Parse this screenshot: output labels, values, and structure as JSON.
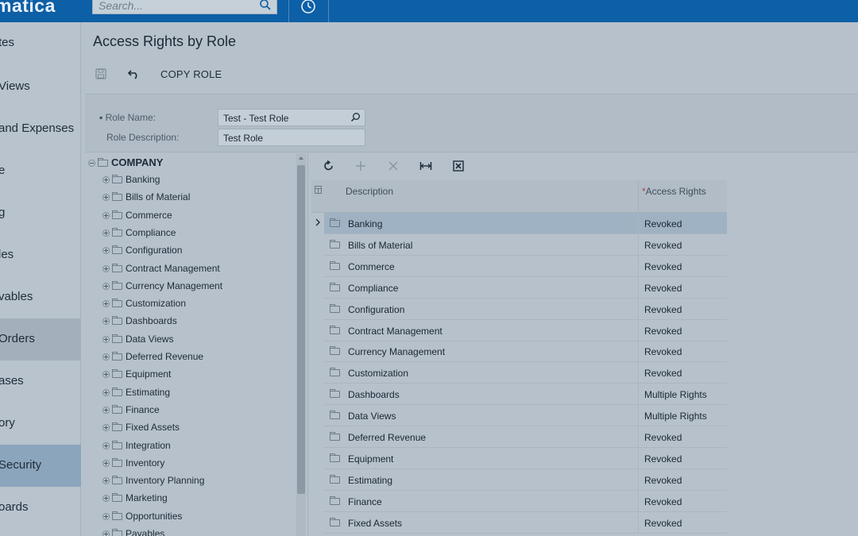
{
  "header": {
    "logo_text": "matica",
    "search_placeholder": "Search..."
  },
  "nav": {
    "items": [
      {
        "label": "tes"
      },
      {
        "label": "Views"
      },
      {
        "label": "and Expenses"
      },
      {
        "label": "e"
      },
      {
        "label": "g"
      },
      {
        "label": "les"
      },
      {
        "label": "vables"
      },
      {
        "label": "Orders"
      },
      {
        "label": "ases"
      },
      {
        "label": "ory"
      },
      {
        "label": "Security"
      },
      {
        "label": "oards"
      }
    ]
  },
  "page": {
    "title": "Access Rights by Role",
    "copy_role_label": "COPY ROLE"
  },
  "form": {
    "role_name_label": "Role Name:",
    "role_name_value": "Test - Test Role",
    "role_description_label": "Role Description:",
    "role_description_value": "Test Role"
  },
  "tree": {
    "root": "COMPANY",
    "nodes": [
      "Banking",
      "Bills of Material",
      "Commerce",
      "Compliance",
      "Configuration",
      "Contract Management",
      "Currency Management",
      "Customization",
      "Dashboards",
      "Data Views",
      "Deferred Revenue",
      "Equipment",
      "Estimating",
      "Finance",
      "Fixed Assets",
      "Integration",
      "Inventory",
      "Inventory Planning",
      "Marketing",
      "Opportunities",
      "Payables"
    ]
  },
  "grid": {
    "columns": {
      "description": "Description",
      "access_rights": "Access Rights"
    },
    "rows": [
      {
        "description": "Banking",
        "access": "Revoked"
      },
      {
        "description": "Bills of Material",
        "access": "Revoked"
      },
      {
        "description": "Commerce",
        "access": "Revoked"
      },
      {
        "description": "Compliance",
        "access": "Revoked"
      },
      {
        "description": "Configuration",
        "access": "Revoked"
      },
      {
        "description": "Contract Management",
        "access": "Revoked"
      },
      {
        "description": "Currency Management",
        "access": "Revoked"
      },
      {
        "description": "Customization",
        "access": "Revoked"
      },
      {
        "description": "Dashboards",
        "access": "Multiple Rights"
      },
      {
        "description": "Data Views",
        "access": "Multiple Rights"
      },
      {
        "description": "Deferred Revenue",
        "access": "Revoked"
      },
      {
        "description": "Equipment",
        "access": "Revoked"
      },
      {
        "description": "Estimating",
        "access": "Revoked"
      },
      {
        "description": "Finance",
        "access": "Revoked"
      },
      {
        "description": "Fixed Assets",
        "access": "Revoked"
      }
    ]
  },
  "icons": {
    "search": "search-icon",
    "history": "history-icon",
    "save": "save-icon",
    "undo": "undo-icon",
    "refresh": "refresh-icon",
    "add": "add-icon",
    "delete": "delete-icon",
    "fit": "fit-columns-icon",
    "export": "export-excel-icon",
    "folder": "folder-icon"
  },
  "colors": {
    "topbar": "#0d5fa6",
    "selected_nav": "#8ba5bd",
    "current_row": "#9fb2c4"
  }
}
